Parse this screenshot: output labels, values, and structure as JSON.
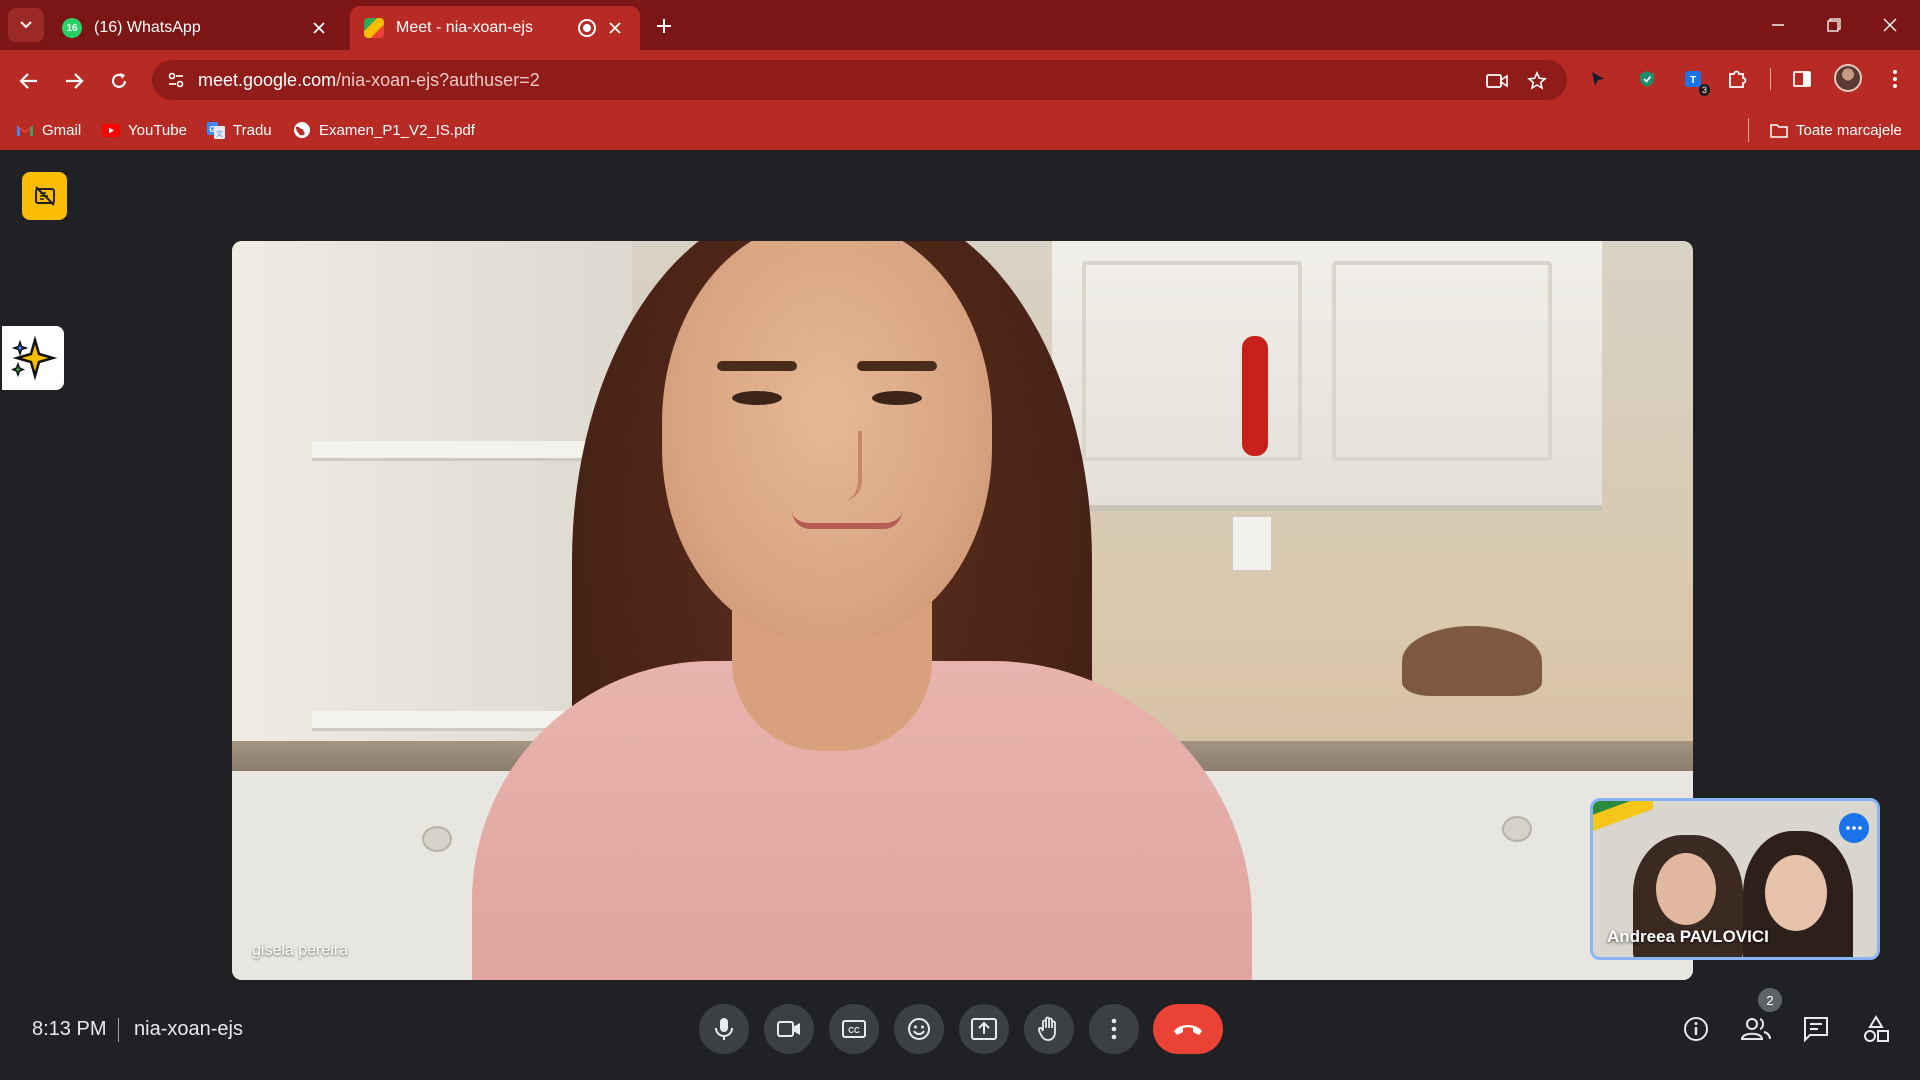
{
  "browser": {
    "tabs": [
      {
        "title": "(16) WhatsApp",
        "badge": "16",
        "icon": "whatsapp-icon",
        "active": false
      },
      {
        "title": "Meet - nia-xoan-ejs",
        "icon": "google-meet-icon",
        "active": true
      }
    ],
    "url_host": "meet.google.com",
    "url_path": "/nia-xoan-ejs?authuser=2",
    "extension_badge": "3",
    "bookmarks": [
      {
        "label": "Gmail",
        "icon": "gmail-icon"
      },
      {
        "label": "YouTube",
        "icon": "youtube-icon"
      },
      {
        "label": "Tradu",
        "icon": "translate-icon"
      },
      {
        "label": "Examen_P1_V2_IS.pdf",
        "icon": "globe-icon"
      }
    ],
    "all_bookmarks": "Toate marcajele",
    "colors": {
      "frame": "#7c1515",
      "toolbar": "#b82b24"
    }
  },
  "meet": {
    "main_participant": "gisela pereira",
    "self_view_name": "Andreea PAVLOVICI",
    "time": "8:13 PM",
    "meeting_code": "nia-xoan-ejs",
    "participants_count": "2",
    "controls": [
      "microphone",
      "camera",
      "captions",
      "emoji-reactions",
      "present-screen",
      "raise-hand",
      "more-options",
      "leave-call"
    ],
    "right_controls": [
      "meeting-details",
      "people",
      "chat",
      "activities"
    ],
    "colors": {
      "background": "#202124",
      "leave": "#ea4335",
      "control": "#3c4043",
      "highlight": "#8ab4f8"
    }
  }
}
